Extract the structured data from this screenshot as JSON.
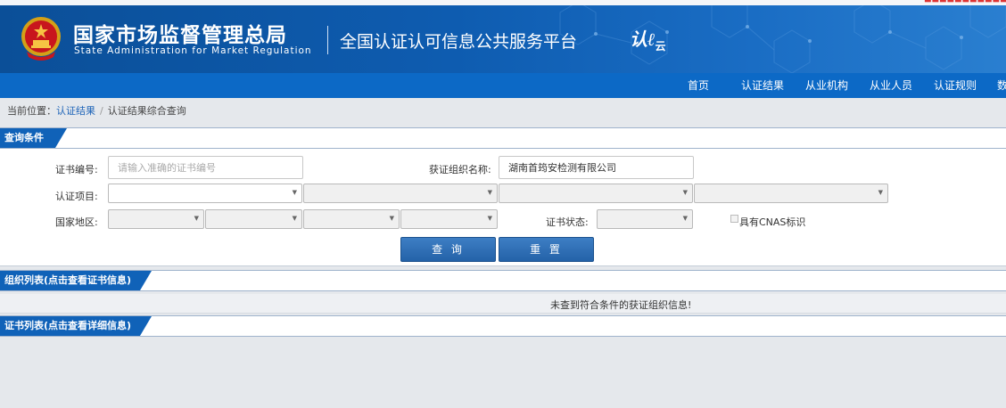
{
  "header": {
    "agency_cn": "国家市场监督管理总局",
    "agency_en": "State Administration  for  Market Regulation",
    "platform": "全国认证认可信息公共服务平台",
    "logo_text": "认",
    "logo_sub": "云",
    "emblem_icon": "national-emblem-icon",
    "colors": {
      "header_blue": "#0e5cb0",
      "nav_blue": "#0c69c6",
      "tab_blue": "#1062b8"
    }
  },
  "nav": {
    "items": [
      "首页",
      "认证结果",
      "从业机构",
      "从业人员",
      "认证规则",
      "数"
    ]
  },
  "breadcrumb": {
    "prefix": "当前位置：",
    "link": "认证结果",
    "separator": "/",
    "current": "认证结果综合查询"
  },
  "query": {
    "section_title": "查询条件",
    "cert_no_label": "证书编号:",
    "cert_no_placeholder": "请输入准确的证书编号",
    "org_name_label": "获证组织名称:",
    "org_name_value": "湖南首筠安检测有限公司",
    "project_label": "认证项目:",
    "region_label": "国家地区:",
    "status_label": "证书状态:",
    "cnas_label": "具有CNAS标识",
    "search_button": "查 询",
    "reset_button": "重 置"
  },
  "org_list": {
    "section_title": "组织列表(点击查看证书信息)",
    "empty_message": "未查到符合条件的获证组织信息!"
  },
  "cert_list": {
    "section_title": "证书列表(点击查看详细信息)"
  }
}
